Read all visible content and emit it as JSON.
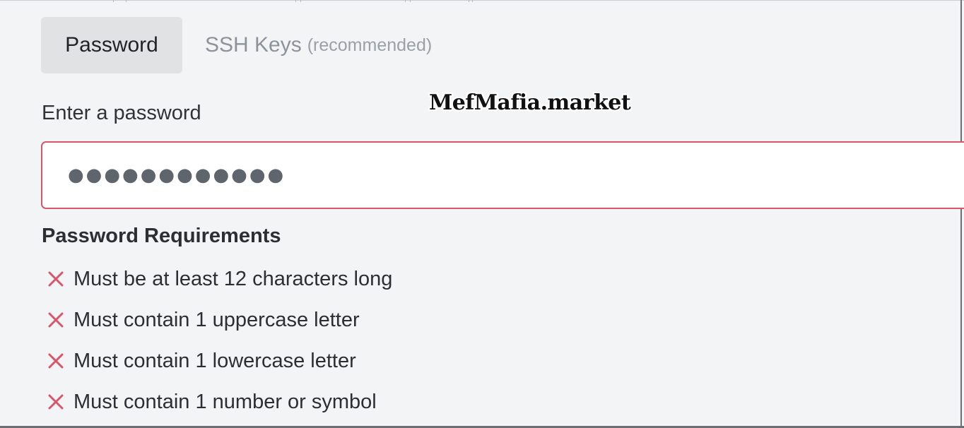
{
  "tabs": [
    {
      "label": "Password",
      "hint": ""
    },
    {
      "label": "SSH Keys",
      "hint": "(recommended)"
    }
  ],
  "watermark": "MefMafia.market",
  "password": {
    "label": "Enter a password",
    "masked_value": "●●●●●●●●●●●●"
  },
  "requirements": {
    "title": "Password Requirements",
    "items": [
      "Must be at least 12 characters long",
      "Must contain 1 uppercase letter",
      "Must contain 1 lowercase letter",
      "Must contain 1 number or symbol"
    ]
  },
  "colors": {
    "error": "#d9566a",
    "background": "#f3f4f6"
  }
}
